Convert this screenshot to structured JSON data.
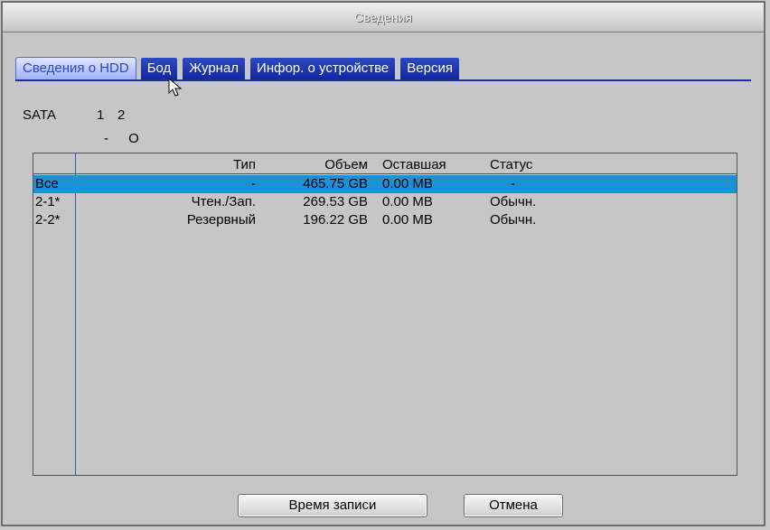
{
  "window": {
    "title": "Сведения"
  },
  "tabs": [
    {
      "label": "Сведения о HDD",
      "state": "active"
    },
    {
      "label": "Бод",
      "state": "normal"
    },
    {
      "label": "Журнал",
      "state": "normal"
    },
    {
      "label": "Инфор. о устройстве",
      "state": "normal"
    },
    {
      "label": "Версия",
      "state": "normal"
    }
  ],
  "sata": {
    "label": "SATA",
    "ports": [
      "1",
      "2"
    ],
    "status": [
      "-",
      "O"
    ]
  },
  "table": {
    "headers": {
      "type": "Тип",
      "volume": "Объем",
      "remaining": "Оставшая",
      "status": "Статус"
    },
    "rows": [
      {
        "name": "Все",
        "type": "-",
        "volume": "465.75 GB",
        "remaining": "0.00 MB",
        "status": "-",
        "selected": true
      },
      {
        "name": "2-1*",
        "type": "Чтен./Зап.",
        "volume": "269.53 GB",
        "remaining": "0.00 MB",
        "status": "Обычн.",
        "selected": false
      },
      {
        "name": "2-2*",
        "type": "Резервный",
        "volume": "196.22 GB",
        "remaining": "0.00 MB",
        "status": "Обычн.",
        "selected": false
      }
    ]
  },
  "buttons": {
    "record_time": "Время записи",
    "cancel": "Отмена"
  },
  "colors": {
    "tab_bg": "#1a2fa4",
    "selection": "#1a92d6",
    "active_tab_text": "#2b46c9"
  }
}
